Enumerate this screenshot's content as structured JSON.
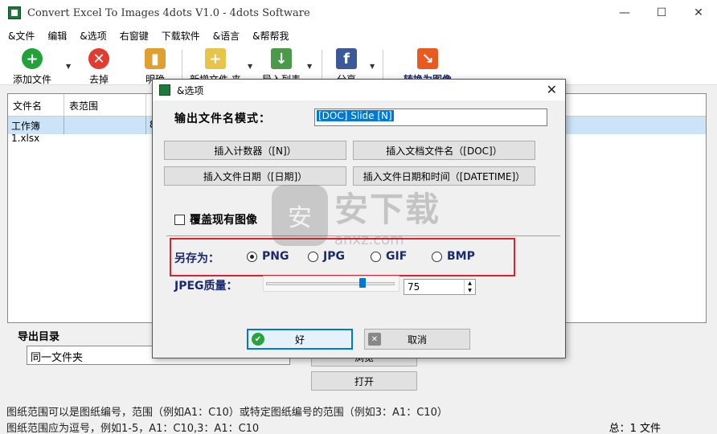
{
  "window": {
    "title": "Convert Excel To Images 4dots V1.0 - 4dots Software",
    "minimize": "—",
    "maximize": "☐",
    "close": "✕"
  },
  "menu": [
    "&文件",
    "编辑",
    "&选项",
    "右窗键",
    "下载软件",
    "&语言",
    "&帮帮我"
  ],
  "toolbar": {
    "add_file": "添加文件",
    "remove": "去掉",
    "clear": "明确",
    "new_file": "新增文件 夹",
    "import_list": "导入列表",
    "share": "分享",
    "convert": "转换为图像"
  },
  "table": {
    "headers": [
      "文件名",
      "表范围",
      "意"
    ],
    "rows": [
      [
        "工作簿1.xlsx",
        "",
        "8"
      ]
    ]
  },
  "export": {
    "label": "导出目录",
    "folder_value": "同一文件夹",
    "browse_button": "浏览",
    "open_button": "打开"
  },
  "status": {
    "line1": "图纸范围可以是图纸编号，范围（例如A1：C10）或特定图纸编号的范围（例如3：A1：C10）",
    "line2": "图纸范围应为逗号，例如1-5，A1：C10,3：A1：C10",
    "total": "总：1 文件"
  },
  "dialog": {
    "title": "&选项",
    "close": "✕",
    "filename_pattern_label": "输出文件名模式：",
    "filename_pattern_value": "[DOC] Slide [N]",
    "insert_counter": "插入计数器（[N]）",
    "insert_docname": "插入文档文件名（[DOC]）",
    "insert_date": "插入文件日期（[日期]）",
    "insert_datetime": "插入文件日期和时间（[DATETIME]）",
    "overwrite_label": "覆盖现有图像",
    "save_as_label": "另存为：",
    "formats": [
      "PNG",
      "JPG",
      "GIF",
      "BMP"
    ],
    "selected_format": "PNG",
    "jpeg_quality_label": "JPEG质量：",
    "jpeg_quality": "75",
    "jpeg_quality_fraction": 0.75,
    "ok": "好",
    "cancel": "取消"
  },
  "watermark": {
    "shield": "安",
    "big": "安下载",
    "small": "anxz.com"
  },
  "colors": {
    "highlight_red": "#e0202a",
    "accent_blue": "#0078d7",
    "label_navy": "#1a2a6c"
  }
}
